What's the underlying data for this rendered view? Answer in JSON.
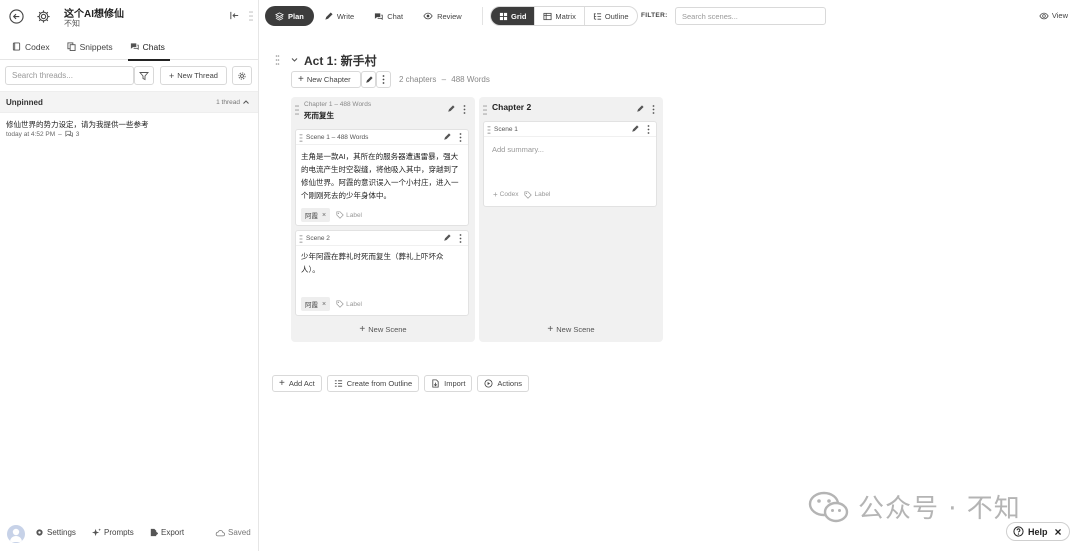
{
  "project": {
    "title": "这个AI想修仙",
    "subtitle": "不知"
  },
  "sidebar": {
    "tabs": [
      {
        "label": "Codex",
        "icon": "book-icon",
        "active": false
      },
      {
        "label": "Snippets",
        "icon": "snippets-icon",
        "active": false
      },
      {
        "label": "Chats",
        "icon": "chats-icon",
        "active": true
      }
    ],
    "search_placeholder": "Search threads...",
    "new_thread_label": "New Thread",
    "unpinned_label": "Unpinned",
    "unpinned_count": "1 thread",
    "threads": [
      {
        "title": "修仙世界的势力设定，请为我提供一些参考",
        "time": "today at 4:52 PM",
        "sep": "–",
        "replies": "3"
      }
    ],
    "footer": {
      "settings": "Settings",
      "prompts": "Prompts",
      "export": "Export",
      "status": "Saved"
    }
  },
  "topbar": {
    "modes": [
      {
        "label": "Plan",
        "icon": "plan-icon",
        "active": true
      },
      {
        "label": "Write",
        "icon": "pen-icon",
        "active": false
      },
      {
        "label": "Chat",
        "icon": "chat-icon",
        "active": false
      },
      {
        "label": "Review",
        "icon": "eye-icon",
        "active": false
      }
    ],
    "views": [
      {
        "label": "Grid",
        "icon": "grid-icon",
        "active": true
      },
      {
        "label": "Matrix",
        "icon": "matrix-icon",
        "active": false
      },
      {
        "label": "Outline",
        "icon": "outline-icon",
        "active": false
      }
    ],
    "filter_label": "FILTER:",
    "search_placeholder": "Search scenes...",
    "view_label": "View"
  },
  "act": {
    "title": "Act 1: 新手村",
    "new_chapter_label": "New Chapter",
    "chapters_count": "2 chapters",
    "sep": "–",
    "words": "488 Words"
  },
  "chapters": [
    {
      "meta": "Chapter 1  –  488 Words",
      "title": "死而复生",
      "scenes": [
        {
          "title": "Scene 1 – 488 Words",
          "summary": "主角是一款AI，其所在的服务器遭遇雷暴，强大的电流产生时空裂缝，将他吸入其中，穿越到了修仙世界。阿霞的意识误入一个小村庄，进入一个刚刚死去的少年身体中。",
          "tag": "阿霞",
          "label": "Label"
        },
        {
          "title": "Scene 2",
          "summary": "少年阿霞在葬礼时死而复生（葬礼上吓坏众人）。",
          "tag": "阿霞",
          "label": "Label"
        }
      ],
      "new_scene": "New Scene"
    },
    {
      "title": "Chapter 2",
      "scenes": [
        {
          "title": "Scene 1",
          "placeholder": "Add summary...",
          "codex": "Codex",
          "label": "Label"
        }
      ],
      "new_scene": "New Scene"
    }
  ],
  "bottom_actions": [
    "Add Act",
    "Create from Outline",
    "Import",
    "Actions"
  ],
  "watermark": "公众号 · 不知",
  "help_label": "Help"
}
